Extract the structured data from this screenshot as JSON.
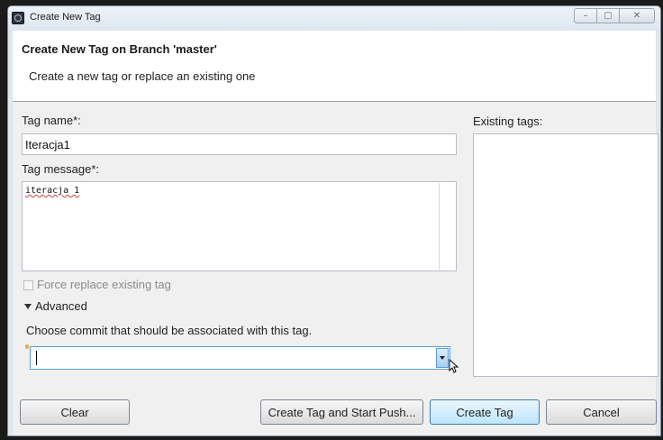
{
  "window": {
    "title": "Create New Tag",
    "min_icon": "minimize-icon",
    "max_icon": "maximize-icon",
    "close_icon": "close-icon"
  },
  "header": {
    "title": "Create New Tag on Branch 'master'",
    "description": "Create a new tag or replace an existing one"
  },
  "form": {
    "tag_name_label": "Tag name*:",
    "tag_name_value": "Iteracja1",
    "tag_message_label": "Tag message*:",
    "tag_message_value": "iteracja 1",
    "existing_tags_label": "Existing tags:",
    "force_replace_label": "Force replace existing tag",
    "advanced_label": "Advanced",
    "commit_hint": "Choose commit that should be associated with this tag.",
    "commit_value": ""
  },
  "buttons": {
    "clear": "Clear",
    "create_and_push": "Create Tag and Start Push...",
    "create": "Create Tag",
    "cancel": "Cancel"
  },
  "colors": {
    "accent": "#5a9bd6",
    "header_bg": "#ffffff",
    "body_bg": "#f0f0f0"
  }
}
